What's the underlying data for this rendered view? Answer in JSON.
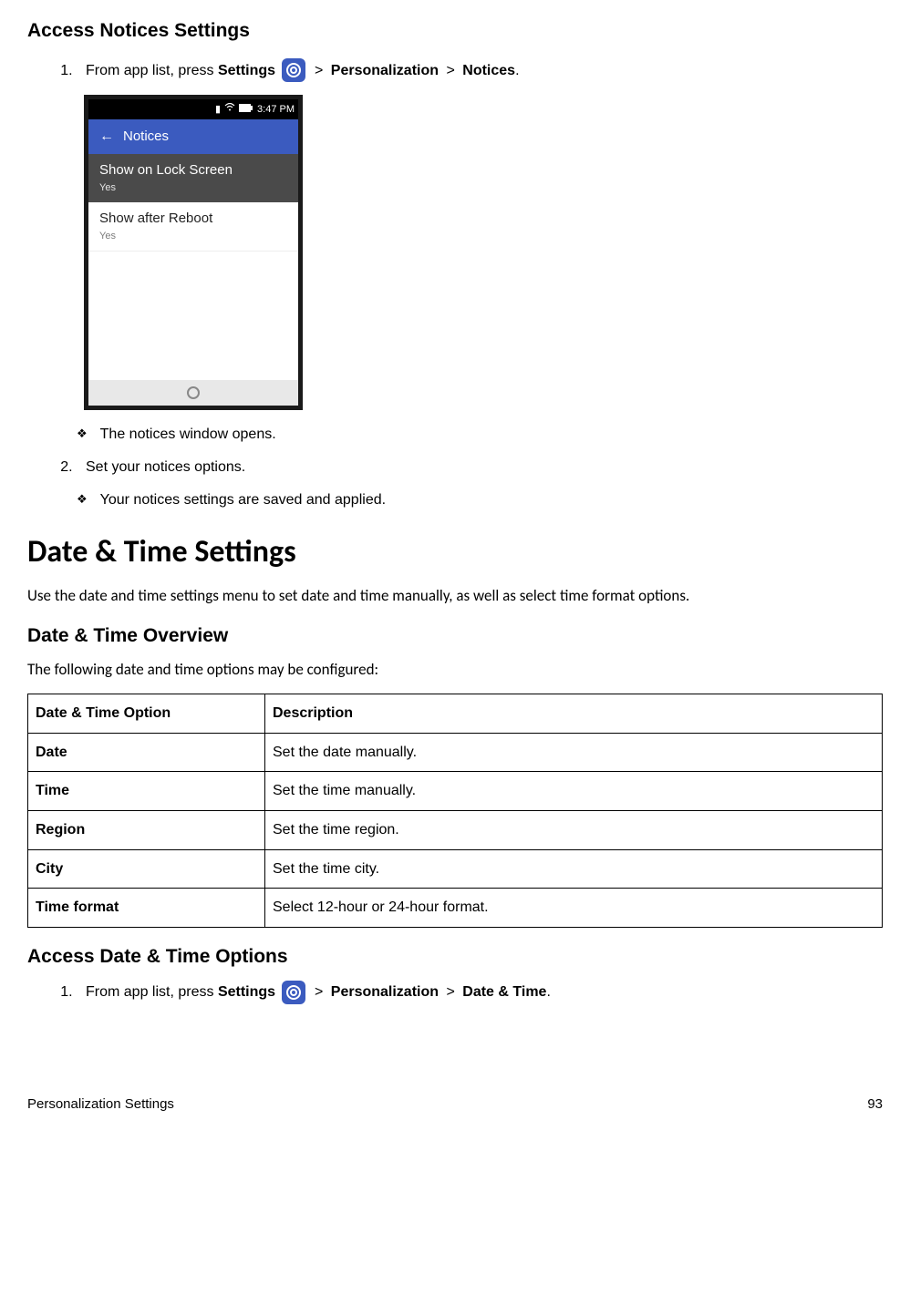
{
  "section1": {
    "heading": "Access Notices Settings",
    "step1_prefix": "From app list, press ",
    "step1_settings": "Settings",
    "step1_path1": "Personalization",
    "step1_path2": "Notices",
    "bullet1": "The notices window opens.",
    "step2": "Set your notices options.",
    "bullet2": "Your notices settings are saved and applied."
  },
  "phone": {
    "time": "3:47 PM",
    "header": "Notices",
    "item1_label": "Show on Lock Screen",
    "item1_val": "Yes",
    "item2_label": "Show after Reboot",
    "item2_val": "Yes"
  },
  "section2": {
    "heading": "Date & Time Settings",
    "intro": "Use the date and time settings menu to set date and time manually, as well as select time format options.",
    "subheading": "Date & Time Overview",
    "table_intro": "The following date and time options may be configured:",
    "table": {
      "header_col1": "Date & Time Option",
      "header_col2": "Description",
      "rows": [
        {
          "opt": "Date",
          "desc": "Set the date manually."
        },
        {
          "opt": "Time",
          "desc": "Set the time manually."
        },
        {
          "opt": "Region",
          "desc": "Set the time region."
        },
        {
          "opt": "City",
          "desc": "Set the time city."
        },
        {
          "opt": "Time format",
          "desc": "Select 12-hour or 24-hour format."
        }
      ]
    }
  },
  "section3": {
    "heading": "Access Date & Time Options",
    "step1_prefix": "From app list, press ",
    "step1_settings": "Settings",
    "step1_path1": "Personalization",
    "step1_path2": "Date & Time"
  },
  "footer": {
    "left": "Personalization Settings",
    "right": "93"
  }
}
